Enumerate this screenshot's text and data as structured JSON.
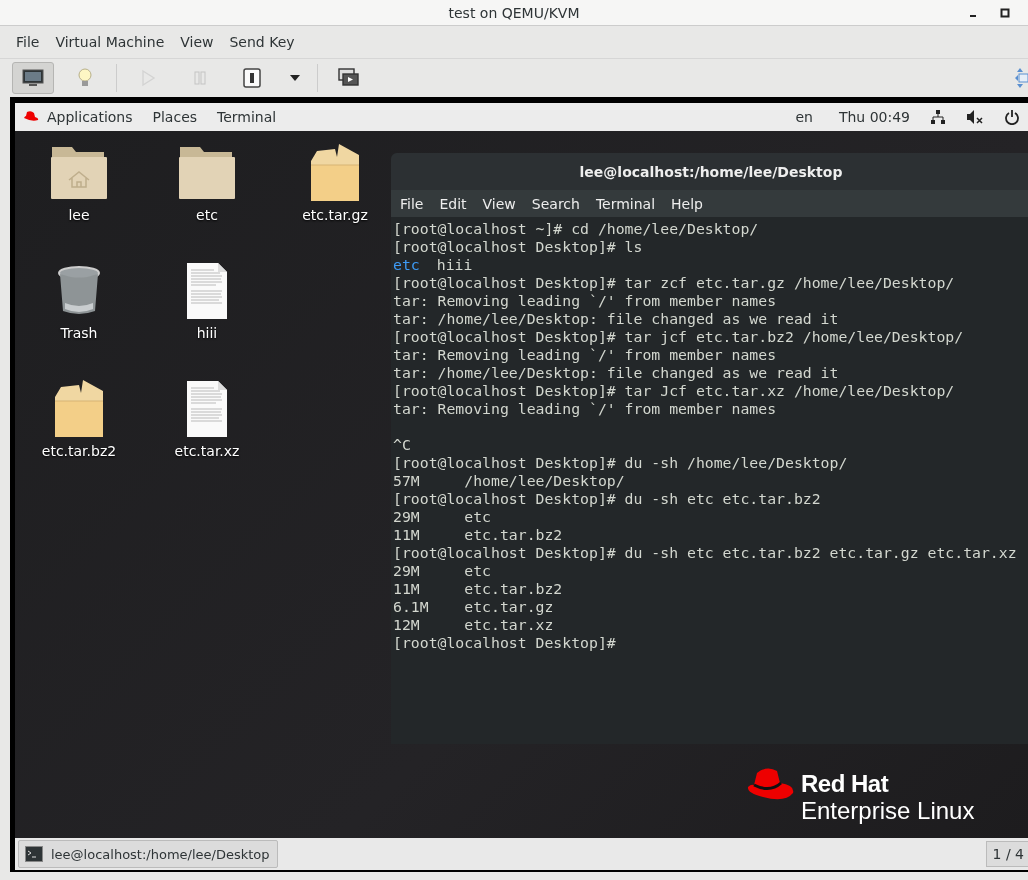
{
  "window": {
    "title": "test on QEMU/KVM"
  },
  "menu": [
    "File",
    "Virtual Machine",
    "View",
    "Send Key"
  ],
  "toolbar": [
    {
      "kind": "console",
      "selected": true,
      "disabled": false
    },
    {
      "kind": "details",
      "selected": false,
      "disabled": false
    },
    {
      "kind": "run",
      "selected": false,
      "disabled": true
    },
    {
      "kind": "pause",
      "selected": false,
      "disabled": true
    },
    {
      "kind": "shutdown",
      "selected": false,
      "disabled": false
    },
    {
      "kind": "dropdown",
      "selected": false,
      "disabled": false
    },
    {
      "kind": "fullscreen",
      "selected": false,
      "disabled": false
    }
  ],
  "guest": {
    "top_bar": {
      "menus": [
        "Applications",
        "Places",
        "Terminal"
      ],
      "language": "en",
      "clock": "Thu 00:49"
    },
    "desktop_icons": [
      [
        {
          "label": "lee",
          "kind": "home"
        },
        {
          "label": "etc",
          "kind": "folder"
        },
        {
          "label": "etc.tar.gz",
          "kind": "archive"
        }
      ],
      [
        {
          "label": "Trash",
          "kind": "trash"
        },
        {
          "label": "hiii",
          "kind": "document"
        }
      ],
      [
        {
          "label": "etc.tar.bz2",
          "kind": "archive"
        },
        {
          "label": "etc.tar.xz",
          "kind": "document"
        }
      ]
    ],
    "terminal": {
      "title": "lee@localhost:/home/lee/Desktop",
      "menu": [
        "File",
        "Edit",
        "View",
        "Search",
        "Terminal",
        "Help"
      ],
      "lines": [
        {
          "kind": "text",
          "text": "[root@localhost ~]# cd /home/lee/Desktop/"
        },
        {
          "kind": "text",
          "text": "[root@localhost Desktop]# ls"
        },
        {
          "kind": "listing",
          "items": [
            {
              "name": "etc",
              "kind": "directory"
            },
            {
              "name": "hiii",
              "kind": "file"
            }
          ]
        },
        {
          "kind": "text",
          "text": "[root@localhost Desktop]# tar zcf etc.tar.gz /home/lee/Desktop/"
        },
        {
          "kind": "text",
          "text": "tar: Removing leading `/' from member names"
        },
        {
          "kind": "text",
          "text": "tar: /home/lee/Desktop: file changed as we read it"
        },
        {
          "kind": "text",
          "text": "[root@localhost Desktop]# tar jcf etc.tar.bz2 /home/lee/Desktop/"
        },
        {
          "kind": "text",
          "text": "tar: Removing leading `/' from member names"
        },
        {
          "kind": "text",
          "text": "tar: /home/lee/Desktop: file changed as we read it"
        },
        {
          "kind": "text",
          "text": "[root@localhost Desktop]# tar Jcf etc.tar.xz /home/lee/Desktop/"
        },
        {
          "kind": "text",
          "text": "tar: Removing leading `/' from member names"
        },
        {
          "kind": "blank"
        },
        {
          "kind": "text",
          "text": "^C"
        },
        {
          "kind": "text",
          "text": "[root@localhost Desktop]# du -sh /home/lee/Desktop/"
        },
        {
          "kind": "text",
          "text": "57M     /home/lee/Desktop/"
        },
        {
          "kind": "text",
          "text": "[root@localhost Desktop]# du -sh etc etc.tar.bz2"
        },
        {
          "kind": "text",
          "text": "29M     etc"
        },
        {
          "kind": "text",
          "text": "11M     etc.tar.bz2"
        },
        {
          "kind": "text",
          "text": "[root@localhost Desktop]# du -sh etc etc.tar.bz2 etc.tar.gz etc.tar.xz"
        },
        {
          "kind": "text",
          "text": "29M     etc"
        },
        {
          "kind": "text",
          "text": "11M     etc.tar.bz2"
        },
        {
          "kind": "text",
          "text": "6.1M    etc.tar.gz"
        },
        {
          "kind": "text",
          "text": "12M     etc.tar.xz"
        },
        {
          "kind": "text",
          "text": "[root@localhost Desktop]#"
        }
      ]
    },
    "branding": {
      "name": "Red Hat",
      "product": "Enterprise Linux"
    },
    "taskbar": {
      "window": "lee@localhost:/home/lee/Desktop",
      "workspace": "1 / 4"
    }
  }
}
